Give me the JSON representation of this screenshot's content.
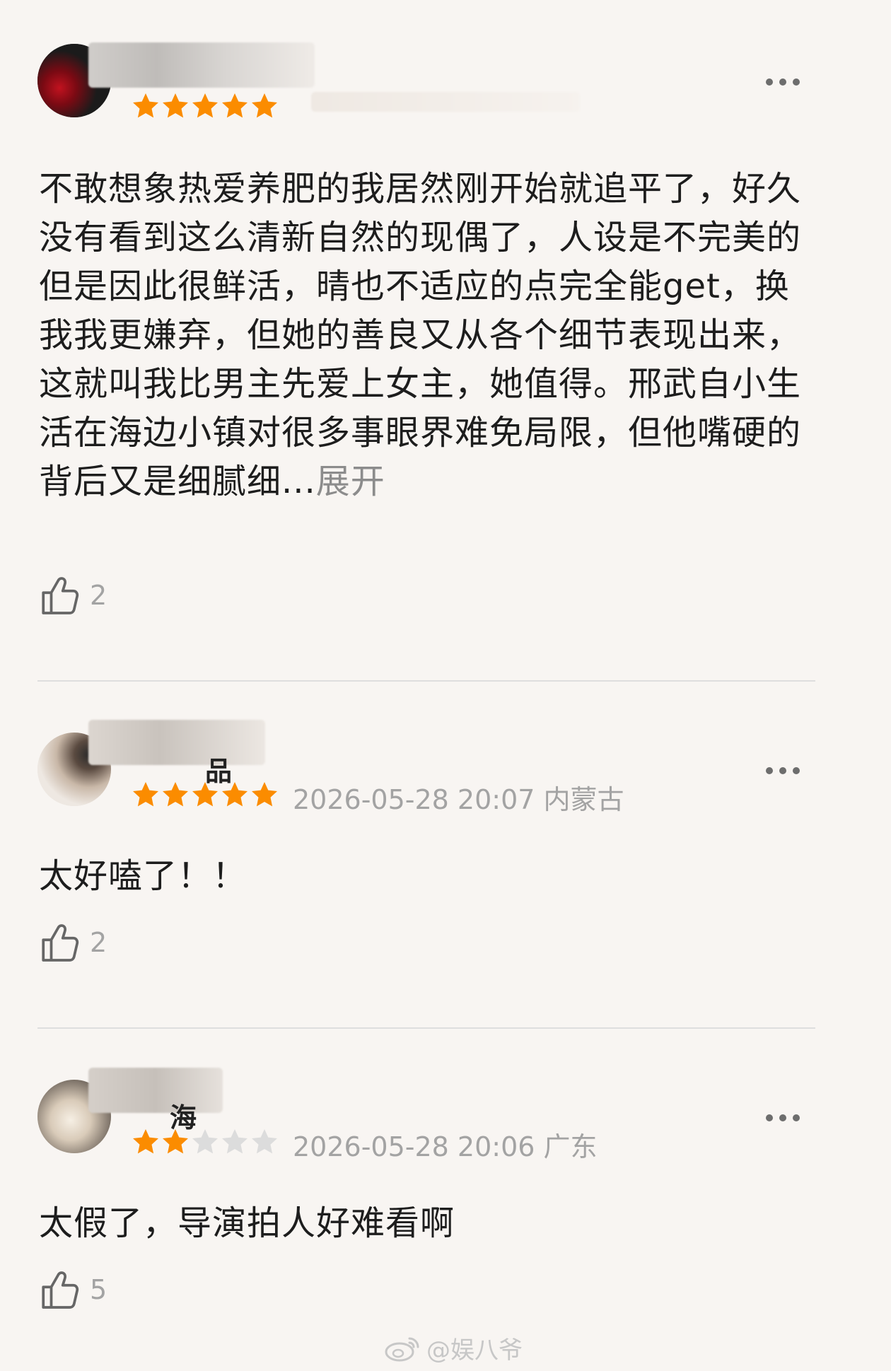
{
  "reviews": [
    {
      "name": "",
      "rating": 5,
      "meta": "2",
      "content": "不敢想象热爱养肥的我居然刚开始就追平了，好久没有看到这么清新自然的现偶了，人设是不完美的但是因此很鲜活，晴也不适应的点完全能get，换我我更嫌弃，但她的善良又从各个细节表现出来，这就叫我比男主先爱上女主，她值得。邢武自小生活在海边小镇对很多事眼界难免局限，但他嘴硬的背后又是细腻细...",
      "expand_label": "展开",
      "likes": "2"
    },
    {
      "name": "品",
      "rating": 5,
      "meta": "2026-05-28 20:07 内蒙古",
      "content": "太好嗑了！！",
      "likes": "2"
    },
    {
      "name": "海",
      "rating": 2,
      "meta": "2026-05-28 20:06 广东",
      "content": "太假了，导演拍人好难看啊",
      "likes": "5"
    }
  ],
  "watermark": "@娱八爷",
  "colors": {
    "background": "#f8f5f2",
    "star_on": "#fb8c00",
    "star_off": "#dcdcdc",
    "meta_text": "#a3a3a3"
  },
  "icons": {
    "more": "more-dots-icon",
    "like": "thumbs-up-icon",
    "star": "star-icon",
    "watermark": "weibo-icon"
  }
}
